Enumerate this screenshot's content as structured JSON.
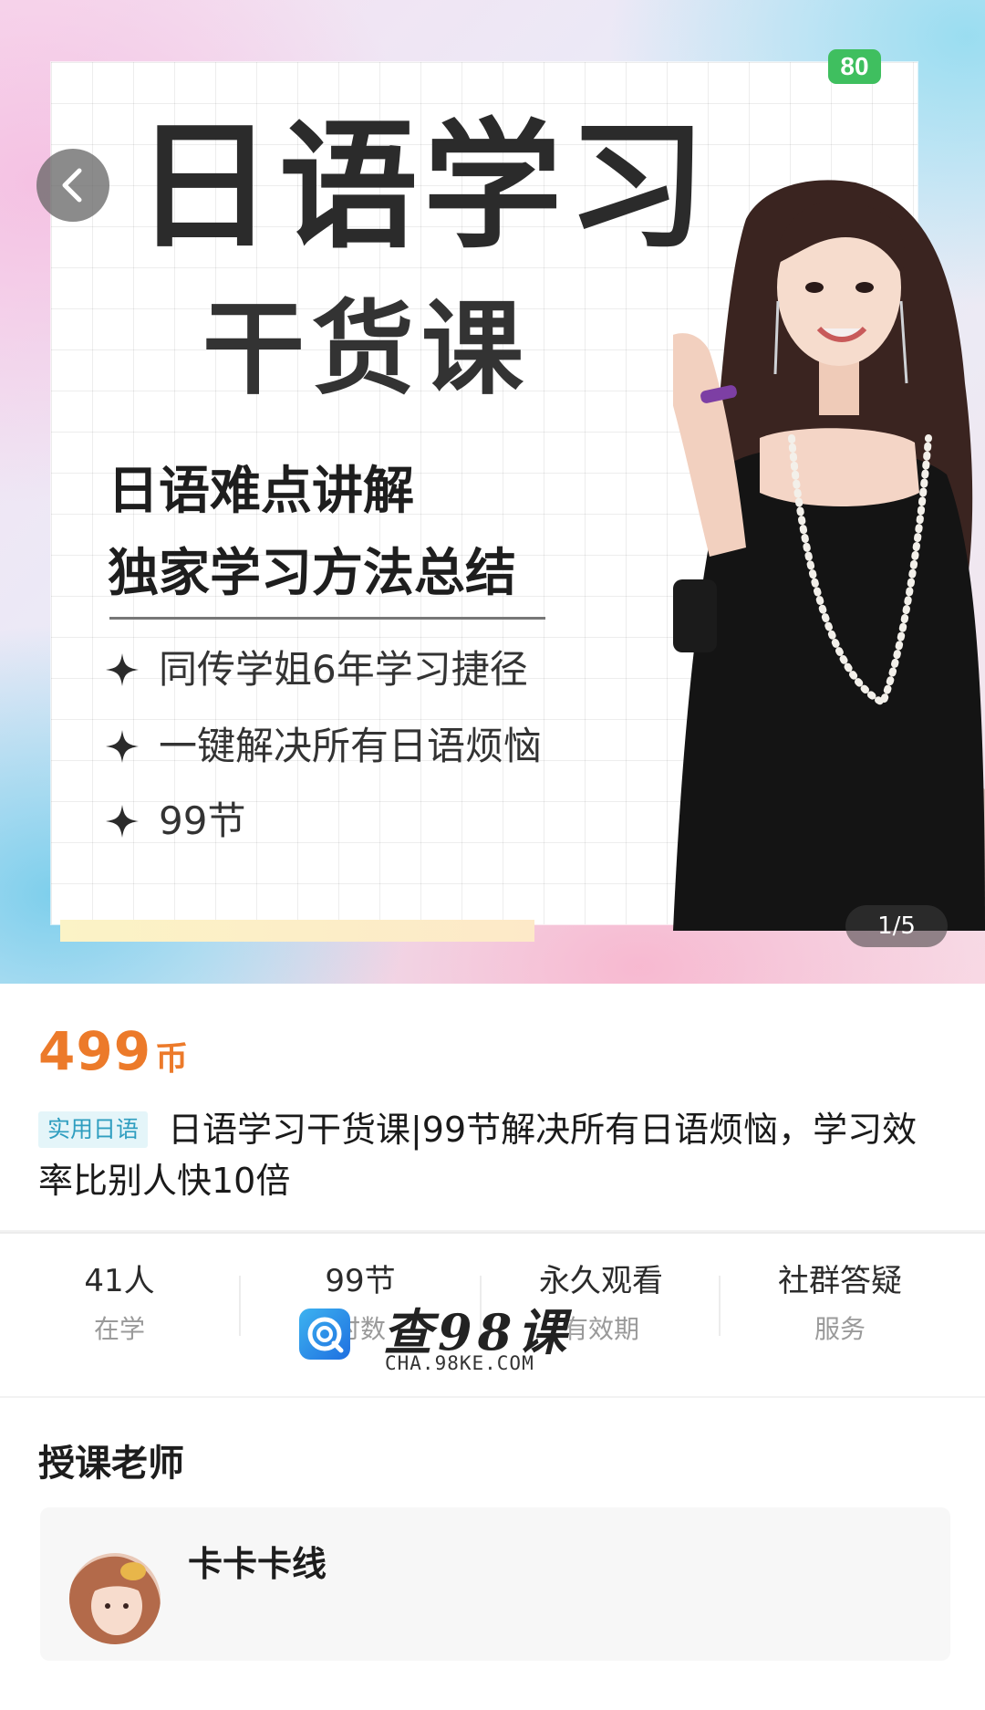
{
  "banner": {
    "status_badge": "80",
    "title": "日语学习",
    "subtitle": "干货课",
    "headlines": [
      "日语难点讲解",
      "独家学习方法总结"
    ],
    "bullets": [
      "同传学姐6年学习捷径",
      "一键解决所有日语烦恼",
      "99节"
    ],
    "image_counter": "1/5"
  },
  "course": {
    "price": "499",
    "price_unit": "币",
    "tag": "实用日语",
    "title": "日语学习干货课|99节解决所有日语烦恼，学习效率比别人快10倍"
  },
  "stats": [
    {
      "value": "41人",
      "label": "在学"
    },
    {
      "value": "99节",
      "label": "时数"
    },
    {
      "value": "永久观看",
      "label": "有效期"
    },
    {
      "value": "社群答疑",
      "label": "服务"
    }
  ],
  "watermark": {
    "text": "查98课",
    "url": "CHA.98KE.COM"
  },
  "teacher_section": {
    "title": "授课老师",
    "teacher_name": "卡卡卡线"
  },
  "colors": {
    "price": "#ec7a2a",
    "tag_bg": "#e4f5f9",
    "tag_text": "#2f9ec0",
    "battery": "#3fbf5f"
  }
}
